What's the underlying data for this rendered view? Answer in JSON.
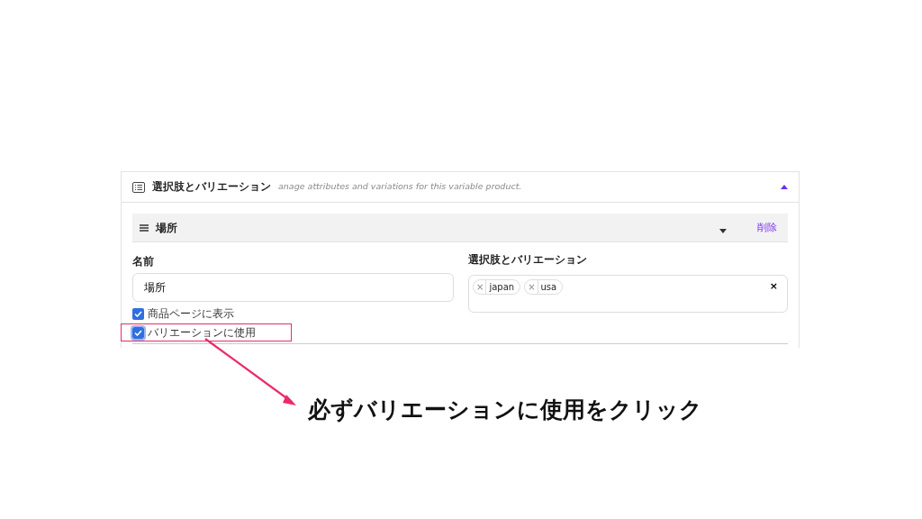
{
  "panel": {
    "title": "選択肢とバリエーション",
    "description": "anage attributes and variations for this variable product.",
    "expanded": true,
    "attribute": {
      "name": "場所",
      "expanded": false,
      "remove": "削除",
      "name_label": "名前",
      "name_value": "場所",
      "values_label": "選択肢とバリエーション",
      "values": [
        {
          "remove": "×",
          "label": "japan"
        },
        {
          "remove": "×",
          "label": "usa"
        }
      ],
      "clear": "×",
      "options": [
        {
          "label": "商品ページに表示",
          "checked": true,
          "highlighted": false
        },
        {
          "label": "バリエーションに使用",
          "checked": true,
          "highlighted": true
        }
      ]
    }
  },
  "callout": {
    "text": "必ずバリエーションに使用をクリック"
  }
}
